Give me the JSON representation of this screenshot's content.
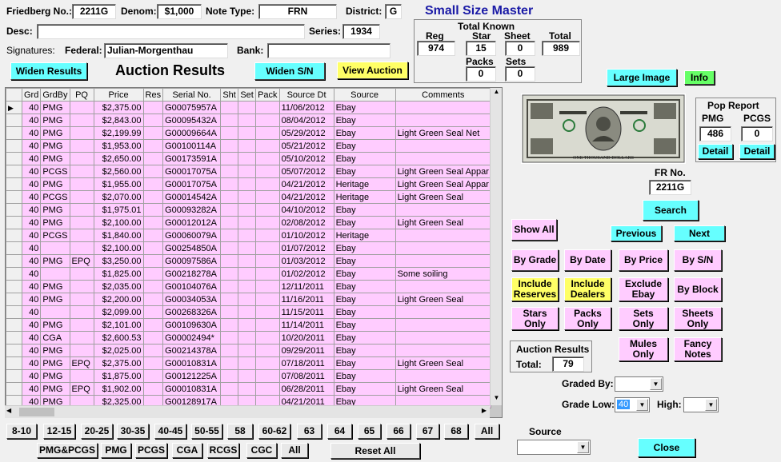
{
  "header": {
    "friedberg_label": "Friedberg No.:",
    "friedberg_value": "2211G",
    "denom_label": "Denom:",
    "denom_value": "$1,000",
    "note_type_label": "Note Type:",
    "note_type_value": "FRN",
    "district_label": "District:",
    "district_value": "G",
    "app_title": "Small Size Master",
    "desc_label": "Desc:",
    "desc_value": "",
    "series_label": "Series:",
    "series_value": "1934",
    "signatures_label": "Signatures:",
    "federal_label": "Federal:",
    "federal_value": "Julian-Morgenthau",
    "bank_label": "Bank:",
    "bank_value": ""
  },
  "total_known": {
    "title": "Total Known",
    "reg_label": "Reg",
    "reg_value": "974",
    "star_label": "Star",
    "star_value": "15",
    "sheet_label": "Sheet",
    "sheet_value": "0",
    "total_label": "Total",
    "total_value": "989",
    "packs_label": "Packs",
    "packs_value": "0",
    "sets_label": "Sets",
    "sets_value": "0"
  },
  "toolbar": {
    "widen_results": "Widen Results",
    "auction_results_title": "Auction Results",
    "widen_sn": "Widen S/N",
    "view_auction": "View Auction"
  },
  "table": {
    "columns": [
      "Grd",
      "GrdBy",
      "PQ",
      "Price",
      "Res",
      "Serial No.",
      "Sht",
      "Set",
      "Pack",
      "Source Dt",
      "Source",
      "Comments"
    ],
    "rows": [
      [
        "40",
        "PMG",
        "",
        "$2,375.00",
        "",
        "G00075957A",
        "",
        "",
        "",
        "11/06/2012",
        "Ebay",
        ""
      ],
      [
        "40",
        "PMG",
        "",
        "$2,843.00",
        "",
        "G00095432A",
        "",
        "",
        "",
        "08/04/2012",
        "Ebay",
        ""
      ],
      [
        "40",
        "PMG",
        "",
        "$2,199.99",
        "",
        "G00009664A",
        "",
        "",
        "",
        "05/29/2012",
        "Ebay",
        "Light Green Seal Net"
      ],
      [
        "40",
        "PMG",
        "",
        "$1,953.00",
        "",
        "G00100114A",
        "",
        "",
        "",
        "05/21/2012",
        "Ebay",
        ""
      ],
      [
        "40",
        "PMG",
        "",
        "$2,650.00",
        "",
        "G00173591A",
        "",
        "",
        "",
        "05/10/2012",
        "Ebay",
        ""
      ],
      [
        "40",
        "PCGS",
        "",
        "$2,560.00",
        "",
        "G00017075A",
        "",
        "",
        "",
        "05/07/2012",
        "Ebay",
        "Light Green Seal Appar"
      ],
      [
        "40",
        "PMG",
        "",
        "$1,955.00",
        "",
        "G00017075A",
        "",
        "",
        "",
        "04/21/2012",
        "Heritage",
        "Light Green Seal Appar"
      ],
      [
        "40",
        "PCGS",
        "",
        "$2,070.00",
        "",
        "G00014542A",
        "",
        "",
        "",
        "04/21/2012",
        "Heritage",
        "Light Green Seal"
      ],
      [
        "40",
        "PMG",
        "",
        "$1,975.01",
        "",
        "G00093282A",
        "",
        "",
        "",
        "04/10/2012",
        "Ebay",
        ""
      ],
      [
        "40",
        "PMG",
        "",
        "$2,100.00",
        "",
        "G00012012A",
        "",
        "",
        "",
        "02/08/2012",
        "Ebay",
        "Light Green Seal"
      ],
      [
        "40",
        "PCGS",
        "",
        "$1,840.00",
        "",
        "G00060079A",
        "",
        "",
        "",
        "01/10/2012",
        "Heritage",
        ""
      ],
      [
        "40",
        "",
        "",
        "$2,100.00",
        "",
        "G00254850A",
        "",
        "",
        "",
        "01/07/2012",
        "Ebay",
        ""
      ],
      [
        "40",
        "PMG",
        "EPQ",
        "$3,250.00",
        "",
        "G00097586A",
        "",
        "",
        "",
        "01/03/2012",
        "Ebay",
        ""
      ],
      [
        "40",
        "",
        "",
        "$1,825.00",
        "",
        "G00218278A",
        "",
        "",
        "",
        "01/02/2012",
        "Ebay",
        "Some soiling"
      ],
      [
        "40",
        "PMG",
        "",
        "$2,035.00",
        "",
        "G00104076A",
        "",
        "",
        "",
        "12/11/2011",
        "Ebay",
        ""
      ],
      [
        "40",
        "PMG",
        "",
        "$2,200.00",
        "",
        "G00034053A",
        "",
        "",
        "",
        "11/16/2011",
        "Ebay",
        "Light Green Seal"
      ],
      [
        "40",
        "",
        "",
        "$2,099.00",
        "",
        "G00268326A",
        "",
        "",
        "",
        "11/15/2011",
        "Ebay",
        ""
      ],
      [
        "40",
        "PMG",
        "",
        "$2,101.00",
        "",
        "G00109630A",
        "",
        "",
        "",
        "11/14/2011",
        "Ebay",
        ""
      ],
      [
        "40",
        "CGA",
        "",
        "$2,600.53",
        "",
        "G00002494*",
        "",
        "",
        "",
        "10/20/2011",
        "Ebay",
        ""
      ],
      [
        "40",
        "PMG",
        "",
        "$2,025.00",
        "",
        "G00214378A",
        "",
        "",
        "",
        "09/29/2011",
        "Ebay",
        ""
      ],
      [
        "40",
        "PMG",
        "EPQ",
        "$2,375.00",
        "",
        "G00010831A",
        "",
        "",
        "",
        "07/18/2011",
        "Ebay",
        "Light Green Seal"
      ],
      [
        "40",
        "PMG",
        "",
        "$1,875.00",
        "",
        "G00121225A",
        "",
        "",
        "",
        "07/08/2011",
        "Ebay",
        ""
      ],
      [
        "40",
        "PMG",
        "EPQ",
        "$1,902.00",
        "",
        "G00010831A",
        "",
        "",
        "",
        "06/28/2011",
        "Ebay",
        "Light Green Seal"
      ],
      [
        "40",
        "PMG",
        "",
        "$2,325.00",
        "",
        "G00128917A",
        "",
        "",
        "",
        "04/21/2011",
        "Ebay",
        ""
      ]
    ]
  },
  "grade_buttons": [
    "8-10",
    "12-15",
    "20-25",
    "30-35",
    "40-45",
    "50-55",
    "58",
    "60-62",
    "63",
    "64",
    "65",
    "66",
    "67",
    "68",
    "All"
  ],
  "grader_buttons": [
    "PMG&PCGS",
    "PMG",
    "PCGS",
    "CGA",
    "RCGS",
    "CGC",
    "All"
  ],
  "reset_all": "Reset All",
  "right": {
    "large_image": "Large Image",
    "info": "Info",
    "pop_report_title": "Pop Report",
    "pmg_label": "PMG",
    "pmg_value": "486",
    "pcgs_label": "PCGS",
    "pcgs_value": "0",
    "detail1": "Detail",
    "detail2": "Detail",
    "fr_no_label": "FR No.",
    "fr_no_value": "2211G",
    "search": "Search",
    "show_all": "Show All",
    "previous": "Previous",
    "next": "Next",
    "by_grade": "By Grade",
    "by_date": "By Date",
    "by_price": "By Price",
    "by_sn": "By S/N",
    "include_reserves_1": "Include",
    "include_reserves_2": "Reserves",
    "include_dealers_1": "Include",
    "include_dealers_2": "Dealers",
    "exclude_ebay_1": "Exclude",
    "exclude_ebay_2": "Ebay",
    "by_block": "By Block",
    "stars_only_1": "Stars",
    "stars_only_2": "Only",
    "packs_only_1": "Packs",
    "packs_only_2": "Only",
    "sets_only_1": "Sets",
    "sets_only_2": "Only",
    "sheets_only_1": "Sheets",
    "sheets_only_2": "Only",
    "auction_results_label": "Auction Results",
    "total_label": "Total:",
    "total_value": "79",
    "mules_only_1": "Mules",
    "mules_only_2": "Only",
    "fancy_notes_1": "Fancy",
    "fancy_notes_2": "Notes",
    "graded_by_label": "Graded By:",
    "graded_by_value": "",
    "grade_low_label": "Grade Low:",
    "grade_low_value": "40",
    "high_label": "High:",
    "high_value": "",
    "source_label": "Source",
    "source_value": "",
    "close": "Close"
  },
  "banknote_caption": "ONE THOUSAND DOLLARS"
}
